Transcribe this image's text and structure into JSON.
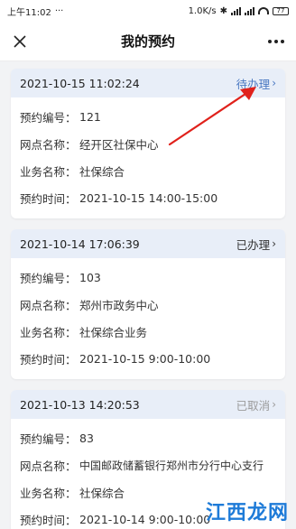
{
  "status_bar": {
    "time": "上午11:02",
    "speed": "1.0K/s",
    "battery": "77"
  },
  "nav": {
    "title": "我的预约",
    "close_icon": "close-icon",
    "more_icon": "more-icon"
  },
  "labels": {
    "number": "预约编号：",
    "outlet": "网点名称：",
    "business": "业务名称：",
    "time": "预约时间："
  },
  "appointments": [
    {
      "created": "2021-10-15 11:02:24",
      "status": "待办理",
      "number": "121",
      "outlet": "经开区社保中心",
      "business": "社保综合",
      "time": "2021-10-15 14:00-15:00"
    },
    {
      "created": "2021-10-14 17:06:39",
      "status": "已办理",
      "number": "103",
      "outlet": "郑州市政务中心",
      "business": "社保综合业务",
      "time": "2021-10-15 9:00-10:00"
    },
    {
      "created": "2021-10-13 14:20:53",
      "status": "已取消",
      "number": "83",
      "outlet": "中国邮政储蓄银行郑州市分行中心支行",
      "business": "社保综合",
      "time": "2021-10-14 9:00-10:00"
    }
  ],
  "watermark": "江西龙网",
  "colors": {
    "pending": "#4a78c2",
    "cancelled": "#9a9a9a",
    "header_bg": "#e8eef8",
    "arrow": "#e0211b"
  }
}
